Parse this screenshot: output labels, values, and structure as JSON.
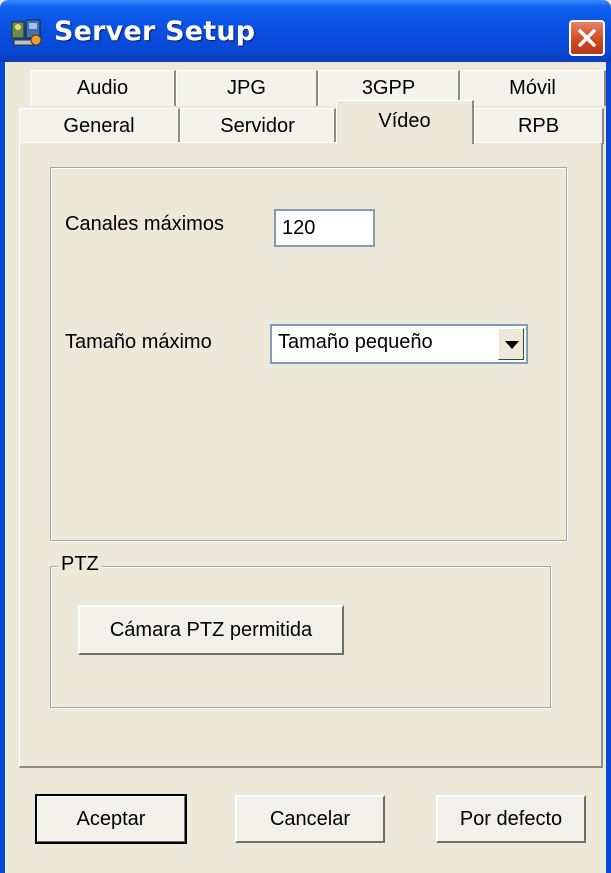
{
  "window": {
    "title": "Server Setup",
    "icon": "server-setup-app-icon",
    "close_icon": "close-icon"
  },
  "tabs_row1": [
    {
      "label": "Audio"
    },
    {
      "label": "JPG"
    },
    {
      "label": "3GPP"
    },
    {
      "label": "Móvil"
    }
  ],
  "tabs_row2": [
    {
      "label": "General"
    },
    {
      "label": "Servidor"
    },
    {
      "label": "Vídeo",
      "active": true
    },
    {
      "label": "RPB"
    }
  ],
  "video": {
    "max_channels_label": "Canales máximos",
    "max_channels_value": "120",
    "max_size_label": "Tamaño máximo",
    "max_size_value": "Tamaño pequeño"
  },
  "ptz": {
    "group_label": "PTZ",
    "enable_button": "Cámara PTZ permitida"
  },
  "footer": {
    "accept": "Aceptar",
    "cancel": "Cancelar",
    "defaults": "Por defecto"
  },
  "colors": {
    "titlebar": "#0A4FE0",
    "window_bg": "#ECE9D8",
    "close_button": "#D04B23"
  }
}
